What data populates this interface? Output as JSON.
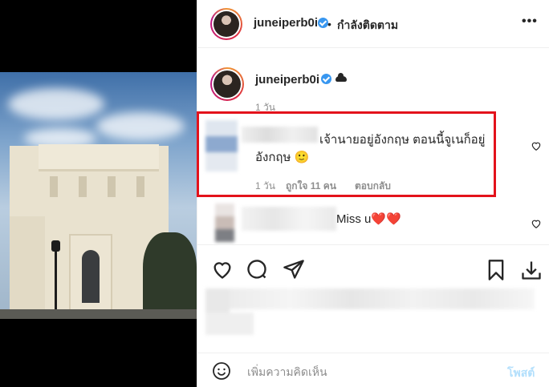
{
  "post": {
    "author": "juneiperb0i",
    "follow_status": "กำลังติดตาม",
    "bullet": "•",
    "more_icon": "more-icon"
  },
  "caption": {
    "author": "juneiperb0i",
    "badge_icon": "cloud-icon",
    "time": "1 วัน"
  },
  "comments": [
    {
      "text": "เจ้านายอยู่อังกฤษ ตอนนี้จูเนก็อยู่อังกฤษ 🙂",
      "time": "1 วัน",
      "likes": "ถูกใจ 11 คน",
      "reply": "ตอบกลับ",
      "highlighted": true
    },
    {
      "text": "Miss u❤️❤️",
      "highlighted": false
    }
  ],
  "actions": {
    "like_icon": "heart-icon",
    "comment_icon": "comment-icon",
    "share_icon": "send-icon",
    "save_icon": "bookmark-icon",
    "download_icon": "download-icon"
  },
  "composer": {
    "placeholder": "เพิ่มความคิดเห็น",
    "post_label": "โพสต์"
  },
  "colors": {
    "highlight": "#e3121b",
    "verified": "#3897f0",
    "post_button": "#b2dffc"
  }
}
